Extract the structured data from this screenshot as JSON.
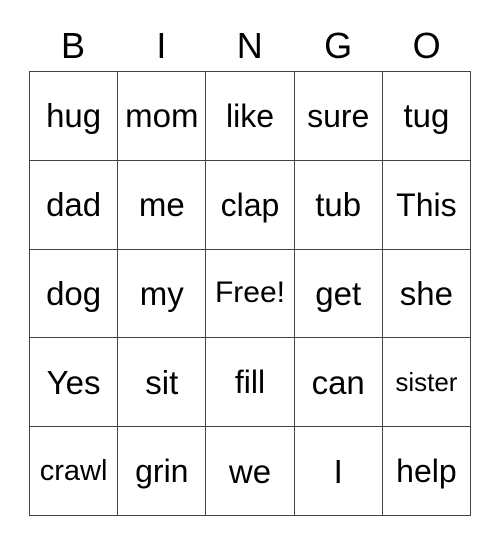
{
  "card": {
    "title_letters": [
      "B",
      "I",
      "N",
      "G",
      "O"
    ],
    "free_space_label": "Free!",
    "border_color": "#444444",
    "background_color": "#ffffff",
    "text_color": "#000000",
    "rows": [
      [
        "hug",
        "mom",
        "like",
        "sure",
        "tug"
      ],
      [
        "dad",
        "me",
        "clap",
        "tub",
        "This"
      ],
      [
        "dog",
        "my",
        "Free!",
        "get",
        "she"
      ],
      [
        "Yes",
        "sit",
        "fill",
        "can",
        "sister"
      ],
      [
        "crawl",
        "grin",
        "we",
        "I",
        "help"
      ]
    ]
  }
}
